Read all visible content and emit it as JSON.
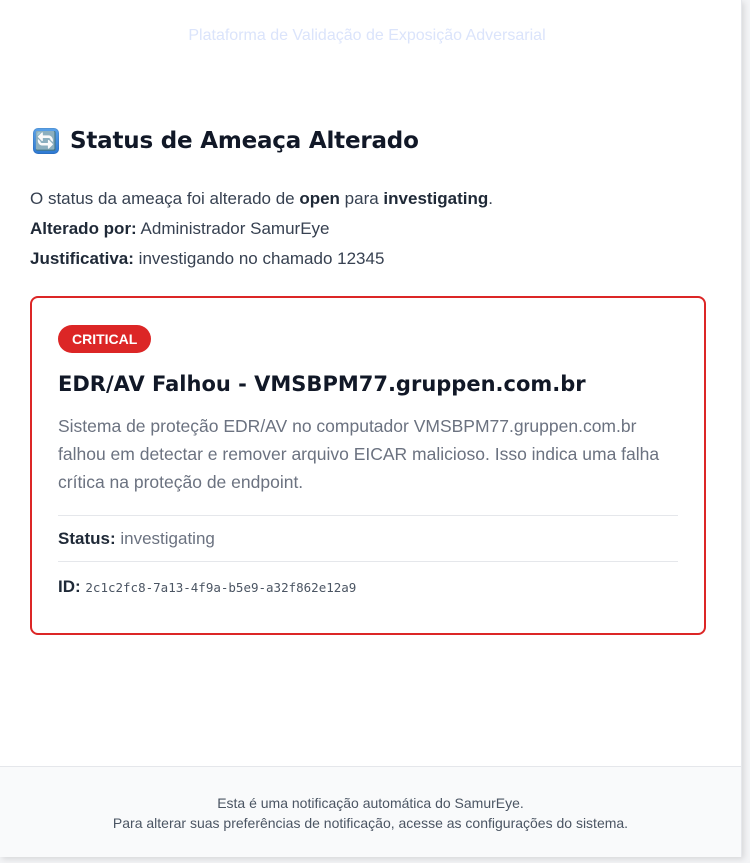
{
  "header": {
    "subtitle": "Plataforma de Validação de Exposição Adversarial"
  },
  "notification": {
    "icon": "refresh-icon",
    "icon_glyph": "🔄",
    "title": "Status de Ameaça Alterado",
    "intro_prefix": "O status da ameaça foi alterado de ",
    "old_status": "open",
    "intro_middle": " para ",
    "new_status": "investigating",
    "intro_suffix": ".",
    "changed_by_label": "Alterado por:",
    "changed_by_value": "Administrador SamurEye",
    "justification_label": "Justificativa:",
    "justification_value": "investigando no chamado 12345"
  },
  "threat": {
    "severity": "CRITICAL",
    "severity_color": "#dc2626",
    "title": "EDR/AV Falhou - VMSBPM77.gruppen.com.br",
    "description": "Sistema de proteção EDR/AV no computador VMSBPM77.gruppen.com.br falhou em detectar e remover arquivo EICAR malicioso. Isso indica uma falha crítica na proteção de endpoint.",
    "status_label": "Status:",
    "status_value": "investigating",
    "id_label": "ID:",
    "id_value": "2c1c2fc8-7a13-4f9a-b5e9-a32f862e12a9"
  },
  "footer": {
    "line1": "Esta é uma notificação automática do SamurEye.",
    "line2": "Para alterar suas preferências de notificação, acesse as configurações do sistema."
  }
}
